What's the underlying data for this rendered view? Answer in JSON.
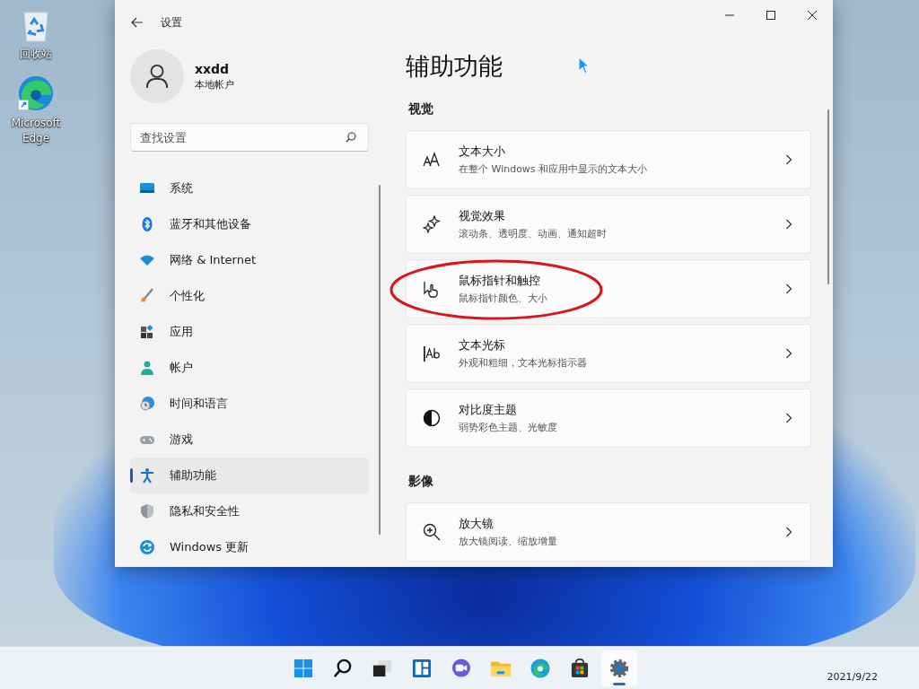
{
  "desktop_icons": [
    {
      "kind": "recycle",
      "label": "回收站"
    },
    {
      "kind": "edge",
      "label": "Microsoft Edge"
    }
  ],
  "window": {
    "title": "设置",
    "account": {
      "name": "xxdd",
      "type": "本地帐户"
    },
    "search": {
      "placeholder": "查找设置"
    },
    "nav": [
      {
        "kind": "system",
        "label": "系统",
        "selected": false
      },
      {
        "kind": "bluetooth",
        "label": "蓝牙和其他设备",
        "selected": false
      },
      {
        "kind": "network",
        "label": "网络 & Internet",
        "selected": false
      },
      {
        "kind": "personalization",
        "label": "个性化",
        "selected": false
      },
      {
        "kind": "apps",
        "label": "应用",
        "selected": false
      },
      {
        "kind": "accounts",
        "label": "帐户",
        "selected": false
      },
      {
        "kind": "time",
        "label": "时间和语言",
        "selected": false
      },
      {
        "kind": "gaming",
        "label": "游戏",
        "selected": false
      },
      {
        "kind": "accessibility",
        "label": "辅助功能",
        "selected": true
      },
      {
        "kind": "privacy",
        "label": "隐私和安全性",
        "selected": false
      },
      {
        "kind": "update",
        "label": "Windows 更新",
        "selected": false
      }
    ],
    "page_title": "辅助功能",
    "sections": [
      {
        "title": "视觉",
        "items": [
          {
            "kind": "textsize",
            "title": "文本大小",
            "description": "在整个 Windows 和应用中显示的文本大小",
            "circled": false
          },
          {
            "kind": "effects",
            "title": "视觉效果",
            "description": "滚动条、透明度、动画、通知超时",
            "circled": false
          },
          {
            "kind": "pointer",
            "title": "鼠标指针和触控",
            "description": "鼠标指针颜色、大小",
            "circled": true
          },
          {
            "kind": "cursor",
            "title": "文本光标",
            "description": "外观和粗细，文本光标指示器",
            "circled": false
          },
          {
            "kind": "contrast",
            "title": "对比度主题",
            "description": "弱势彩色主题、光敏度",
            "circled": false
          }
        ]
      },
      {
        "title": "影像",
        "items": [
          {
            "kind": "magnifier",
            "title": "放大镜",
            "description": "放大镜阅读、缩放增量",
            "circled": false
          }
        ]
      }
    ]
  },
  "taskbar": {
    "apps": [
      {
        "kind": "start",
        "active": false
      },
      {
        "kind": "search",
        "active": false
      },
      {
        "kind": "taskview",
        "active": false
      },
      {
        "kind": "widgets",
        "active": false
      },
      {
        "kind": "chat",
        "active": false
      },
      {
        "kind": "explorer",
        "active": false
      },
      {
        "kind": "edge",
        "active": false
      },
      {
        "kind": "store",
        "active": false
      },
      {
        "kind": "settings",
        "active": true
      }
    ],
    "date": "2021/9/22"
  }
}
